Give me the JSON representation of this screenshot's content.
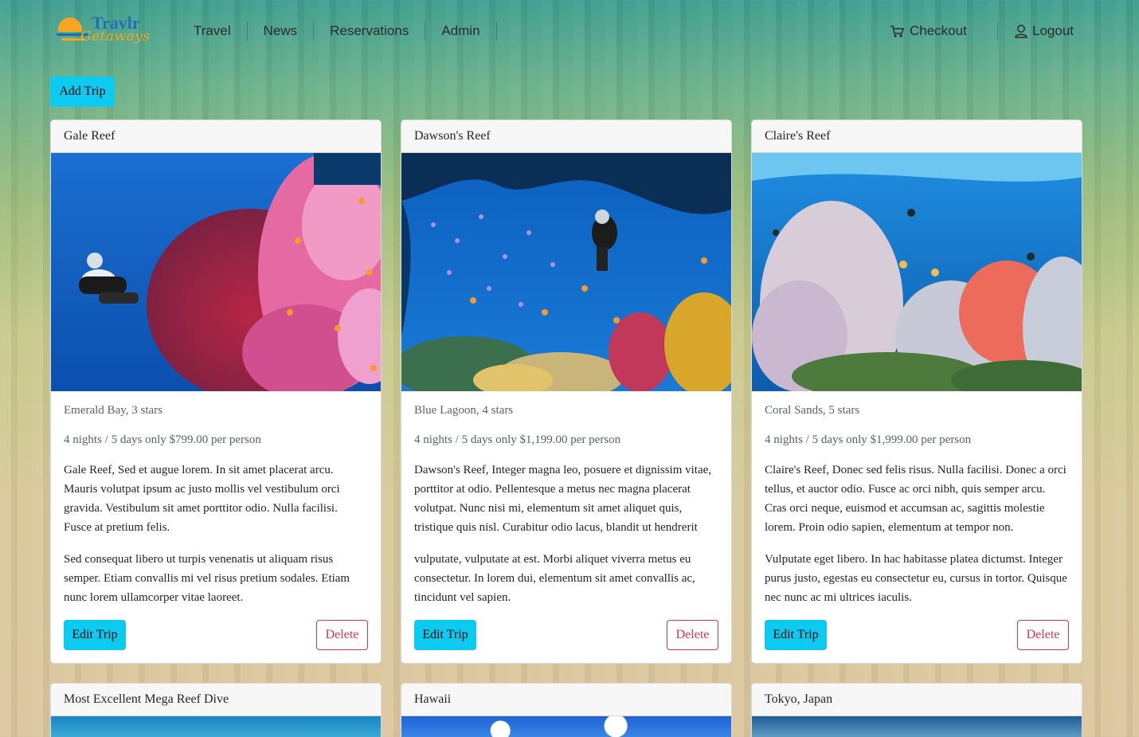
{
  "logo": {
    "top_text": "Travlr",
    "bottom_text": "Getaways"
  },
  "nav": {
    "items": [
      {
        "label": "Travel"
      },
      {
        "label": "News"
      },
      {
        "label": "Reservations"
      },
      {
        "label": "Admin"
      }
    ],
    "checkout_label": "Checkout",
    "logout_label": "Logout"
  },
  "add_trip_label": "Add Trip",
  "colors": {
    "accent": "#0dcaf0",
    "danger": "#dc3545"
  },
  "trips": [
    {
      "name": "Gale Reef",
      "resort": "Emerald Bay, 3 stars",
      "length": "4 nights / 5 days only $799.00 per person",
      "desc1": "Gale Reef, Sed et augue lorem. In sit amet placerat arcu. Mauris volutpat ipsum ac justo mollis vel vestibulum orci gravida. Vestibulum sit amet porttitor odio. Nulla facilisi. Fusce at pretium felis.",
      "desc2": "Sed consequat libero ut turpis venenatis ut aliquam risus semper. Etiam convallis mi vel risus pretium sodales. Etiam nunc lorem ullamcorper vitae laoreet.",
      "edit_label": "Edit Trip",
      "delete_label": "Delete"
    },
    {
      "name": "Dawson's Reef",
      "resort": "Blue Lagoon, 4 stars",
      "length": "4 nights / 5 days only $1,199.00 per person",
      "desc1": "Dawson's Reef, Integer magna leo, posuere et dignissim vitae, porttitor at odio. Pellentesque a metus nec magna placerat volutpat. Nunc nisi mi, elementum sit amet aliquet quis, tristique quis nisl. Curabitur odio lacus, blandit ut hendrerit",
      "desc2": "vulputate, vulputate at est. Morbi aliquet viverra metus eu consectetur. In lorem dui, elementum sit amet convallis ac, tincidunt vel sapien.",
      "edit_label": "Edit Trip",
      "delete_label": "Delete"
    },
    {
      "name": "Claire's Reef",
      "resort": "Coral Sands, 5 stars",
      "length": "4 nights / 5 days only $1,999.00 per person",
      "desc1": "Claire's Reef, Donec sed felis risus. Nulla facilisi. Donec a orci tellus, et auctor odio. Fusce ac orci nibh, quis semper arcu. Cras orci neque, euismod et accumsan ac, sagittis molestie lorem. Proin odio sapien, elementum at tempor non.",
      "desc2": "Vulputate eget libero. In hac habitasse platea dictumst. Integer purus justo, egestas eu consectetur eu, cursus in tortor. Quisque nec nunc ac mi ultrices iaculis.",
      "edit_label": "Edit Trip",
      "delete_label": "Delete"
    }
  ],
  "more_trips": [
    {
      "name": "Most Excellent Mega Reef Dive"
    },
    {
      "name": "Hawaii"
    },
    {
      "name": "Tokyo, Japan"
    }
  ]
}
